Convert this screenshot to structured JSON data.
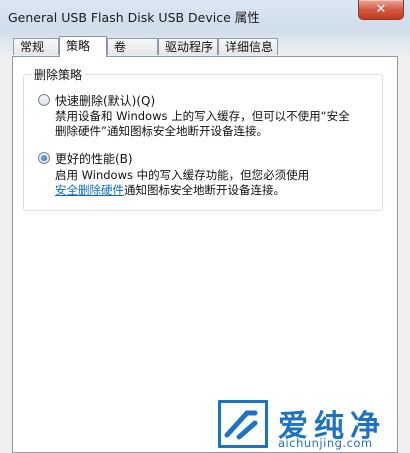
{
  "window": {
    "title": "General USB Flash Disk USB Device 属性",
    "close_label": "✕"
  },
  "tabs": [
    {
      "label": "常规"
    },
    {
      "label": "策略"
    },
    {
      "label": "卷"
    },
    {
      "label": "驱动程序"
    },
    {
      "label": "详细信息"
    }
  ],
  "active_tab": "策略",
  "removal_policy": {
    "group_label": "删除策略",
    "quick_removal": {
      "label": "快速删除(默认)(Q)",
      "selected": false,
      "description_line1": "禁用设备和 Windows 上的写入缓存，但可以不使用“安全",
      "description_line2": "删除硬件”通知图标安全地断开设备连接。"
    },
    "better_performance": {
      "label": "更好的性能(B)",
      "selected": true,
      "description_line1": "启用 Windows 中的写入缓存功能，但您必须使用",
      "link_text": "安全删除硬件",
      "description_line2_rest": "通知图标安全地断开设备连接。"
    }
  },
  "watermark": {
    "brand": "爱纯净",
    "url": "aichunjing.com",
    "color": "#1e73c0"
  }
}
